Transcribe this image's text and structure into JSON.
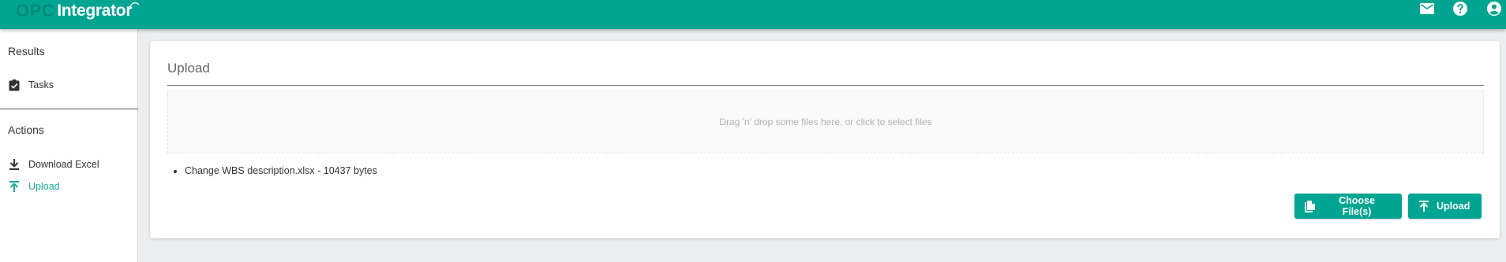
{
  "app": {
    "logo_prefix": "OPC",
    "logo_name": "Integrator"
  },
  "topbar": {
    "icons": [
      "mail-icon",
      "help-icon",
      "account-circle-icon"
    ]
  },
  "sidebar": {
    "results_title": "Results",
    "results_items": [
      {
        "label": "Tasks",
        "icon": "assignment-check-icon"
      }
    ],
    "actions_title": "Actions",
    "actions_items": [
      {
        "label": "Download Excel",
        "icon": "download-icon"
      },
      {
        "label": "Upload",
        "icon": "upload-icon",
        "active": true
      }
    ]
  },
  "main": {
    "title": "Upload",
    "dropzone_text": "Drag 'n' drop some files here, or click to select files",
    "files": [
      "Change WBS description.xlsx - 10437 bytes"
    ],
    "choose_button": "Choose File(s)",
    "upload_button": "Upload"
  },
  "colors": {
    "primary": "#00a591",
    "active_link": "#1aab9b",
    "background": "#eceff1"
  }
}
